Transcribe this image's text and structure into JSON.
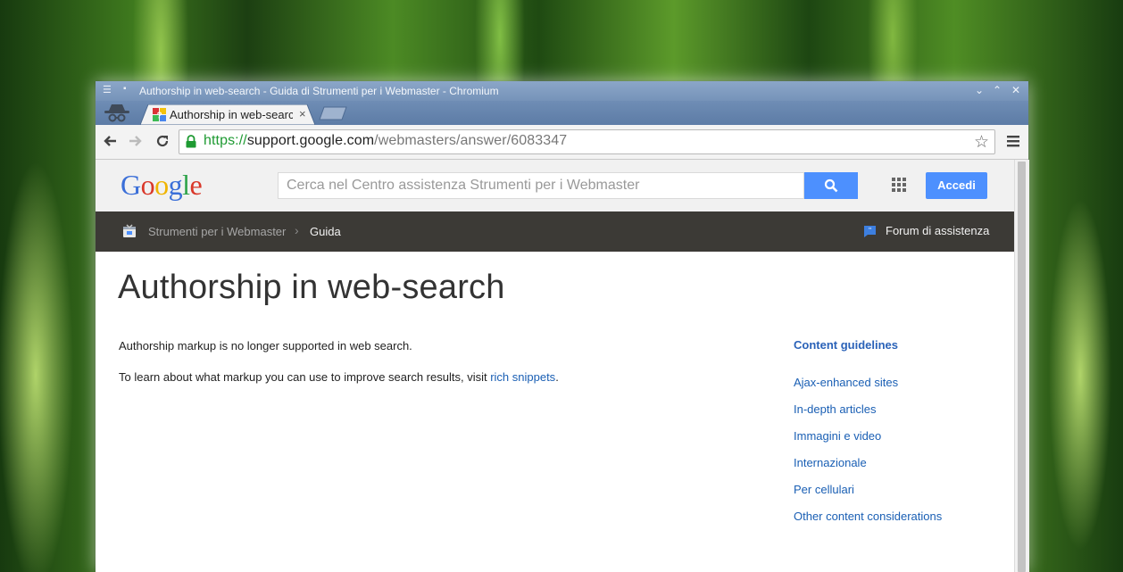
{
  "window": {
    "title": "Authorship in web-search - Guida di Strumenti per i Webmaster - Chromium",
    "controls": {
      "minimize": "⌄",
      "maximize": "⌃",
      "close": "✕"
    }
  },
  "tab": {
    "title": "Authorship in web-search",
    "close": "×"
  },
  "address_bar": {
    "scheme": "https://",
    "host": "support.google.com",
    "path": "/webmasters/answer/6083347"
  },
  "header": {
    "logo": [
      {
        "ch": "G",
        "color": "#3b6fd8"
      },
      {
        "ch": "o",
        "color": "#d9382a"
      },
      {
        "ch": "o",
        "color": "#f0b400"
      },
      {
        "ch": "g",
        "color": "#3b6fd8"
      },
      {
        "ch": "l",
        "color": "#2ea34a"
      },
      {
        "ch": "e",
        "color": "#d9382a"
      }
    ],
    "search_placeholder": "Cerca nel Centro assistenza Strumenti per i Webmaster",
    "signin_label": "Accedi"
  },
  "breadcrumb": {
    "product": "Strumenti per i Webmaster",
    "current": "Guida",
    "forum": "Forum di assistenza"
  },
  "article": {
    "title": "Authorship in web-search",
    "p1": "Authorship markup is no longer supported in web search.",
    "p2_before": "To learn about what markup you can use to improve search results, visit ",
    "p2_link": "rich snippets",
    "p2_after": "."
  },
  "sidebar": {
    "heading": "Content guidelines",
    "links": [
      "Ajax-enhanced sites",
      "In-depth articles",
      "Immagini e video",
      "Internazionale",
      "Per cellulari",
      "Other content considerations"
    ]
  },
  "colors": {
    "accent_blue": "#4d90fe",
    "link_blue": "#1a5fb4",
    "dark_bar": "#3c3a36",
    "secure_green": "#1e9a32"
  }
}
